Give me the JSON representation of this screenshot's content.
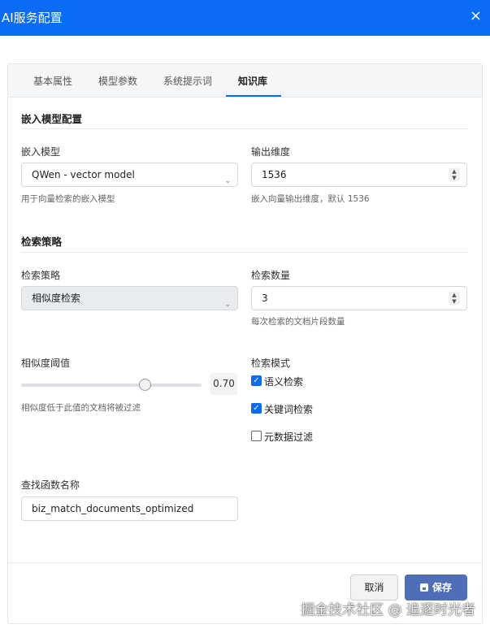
{
  "window": {
    "title": "AI服务配置",
    "close_icon": "×"
  },
  "tabs": [
    {
      "label": "基本属性",
      "active": false
    },
    {
      "label": "模型参数",
      "active": false
    },
    {
      "label": "系统提示词",
      "active": false
    },
    {
      "label": "知识库",
      "active": true
    }
  ],
  "embedding": {
    "section_title": "嵌入模型配置",
    "model": {
      "label": "嵌入模型",
      "value": "QWen - vector model",
      "help": "用于向量检索的嵌入模型"
    },
    "dimension": {
      "label": "输出维度",
      "value": "1536",
      "help": "嵌入向量输出维度，默认 1536"
    }
  },
  "retrieval": {
    "section_title": "检索策略",
    "strategy": {
      "label": "检索策略",
      "value": "相似度检索"
    },
    "count": {
      "label": "检索数量",
      "value": "3",
      "help": "每次检索的文档片段数量"
    },
    "threshold": {
      "label": "相似度阈值",
      "value": "0.70",
      "level": 0.7,
      "help": "相似度低于此值的文档将被过滤"
    },
    "mode": {
      "label": "检索模式",
      "options": [
        {
          "label": "语义检索",
          "checked": true
        },
        {
          "label": "关键词检索",
          "checked": true
        },
        {
          "label": "元数据过滤",
          "checked": false
        }
      ]
    }
  },
  "function": {
    "label": "查找函数名称",
    "value": "biz_match_documents_optimized"
  },
  "footer": {
    "cancel_label": "取消",
    "save_label": "保存"
  },
  "watermark": "掘金技术社区 @ 追逐时光者",
  "colors": {
    "titlebar": "#0a6cf5",
    "accent": "#0a6cf5",
    "save_button": "#4e6fb8"
  }
}
